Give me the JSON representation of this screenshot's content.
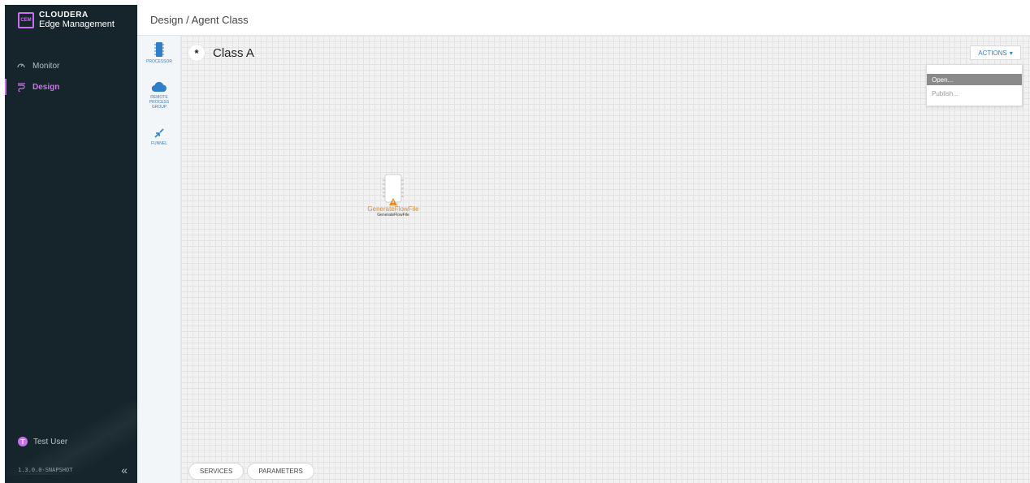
{
  "app": {
    "logo_abbr": "CEM",
    "brand": "CLOUDERA",
    "product": "Edge Management"
  },
  "nav": {
    "items": [
      {
        "label": "Monitor",
        "icon": "gauge-icon"
      },
      {
        "label": "Design",
        "icon": "flow-icon"
      }
    ]
  },
  "user": {
    "initial": "T",
    "name": "Test User"
  },
  "version": "1.3.0.0-SNAPSHOT",
  "header": {
    "breadcrumb": "Design / Agent Class"
  },
  "palette": {
    "processor": "PROCESSOR",
    "remote_process_group_line1": "REMOTE",
    "remote_process_group_line2": "PROCESS",
    "remote_process_group_line3": "GROUP",
    "funnel": "FUNNEL"
  },
  "canvas": {
    "class_badge": "*",
    "class_name": "Class A",
    "actions_label": "ACTIONS",
    "menu": {
      "open": "Open...",
      "publish": "Publish..."
    },
    "processor": {
      "name": "GenerateFlowFile",
      "type": "GenerateFlowFile",
      "status": "warning"
    }
  },
  "bottom": {
    "services": "SERVICES",
    "parameters": "PARAMETERS"
  },
  "colors": {
    "sidebar_bg": "#15252b",
    "accent_purple": "#c970f0",
    "link_blue": "#2f7ec9",
    "processor_orange": "#d38a3c"
  }
}
